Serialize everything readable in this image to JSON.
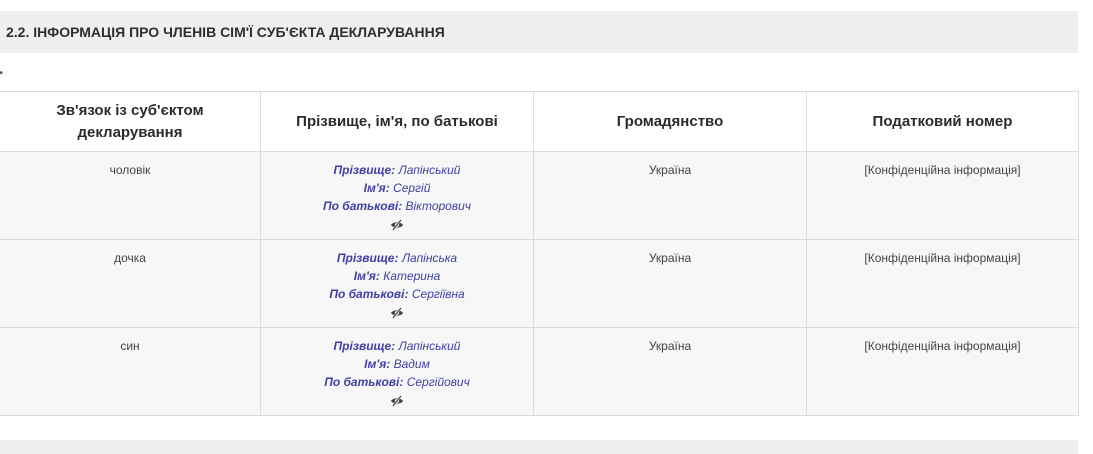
{
  "section": {
    "title": "2.2.  ІНФОРМАЦІЯ ПРО ЧЛЕНІВ СІМ'Ї СУБ'ЄКТА ДЕКЛАРУВАННЯ",
    "dots": "••"
  },
  "table": {
    "headers": [
      "Зв'язок із суб'єктом декларування",
      "Прізвище, ім'я, по батькові",
      "Громадянство",
      "Податковий номер"
    ],
    "name_labels": {
      "surname": "Прізвище:",
      "first_name": "Ім'я:",
      "patronymic": "По батькові:"
    },
    "rows": [
      {
        "relation": "чоловік",
        "surname": "Лапінський",
        "first_name": "Сергій",
        "patronymic": "Вікторович",
        "citizenship": "Україна",
        "tax_number": "[Конфіденційна інформація]"
      },
      {
        "relation": "дочка",
        "surname": "Лапінська",
        "first_name": "Катерина",
        "patronymic": "Сергіївна",
        "citizenship": "Україна",
        "tax_number": "[Конфіденційна інформація]"
      },
      {
        "relation": "син",
        "surname": "Лапінський",
        "first_name": "Вадим",
        "patronymic": "Сергійович",
        "citizenship": "Україна",
        "tax_number": "[Конфіденційна інформація]"
      }
    ]
  },
  "icons": {
    "hidden": "eye-slash-icon"
  },
  "colors": {
    "name_text": "#3f3fa6",
    "header_bg": "#efefef",
    "row_bg": "#f7f7f7"
  }
}
